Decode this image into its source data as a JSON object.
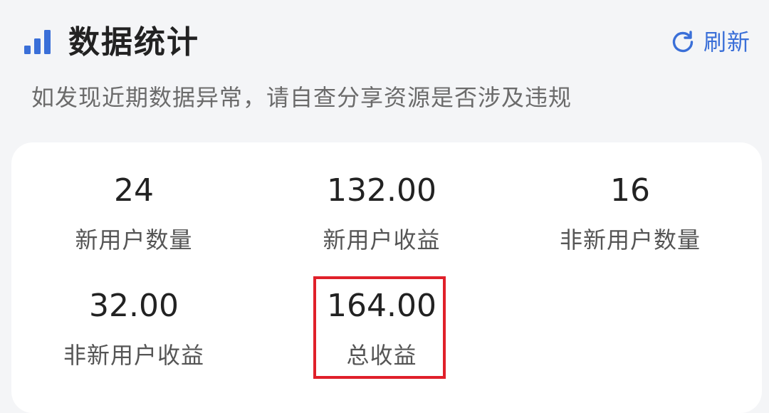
{
  "header": {
    "title": "数据统计",
    "refresh_label": "刷新",
    "icon": "bar-chart-icon",
    "refresh_icon": "refresh-icon",
    "accent_color": "#3a6fd8"
  },
  "notice": "如发现近期数据异常，请自查分享资源是否涉及违规",
  "stats": [
    {
      "value": "24",
      "label": "新用户数量"
    },
    {
      "value": "132.00",
      "label": "新用户收益"
    },
    {
      "value": "16",
      "label": "非新用户数量"
    },
    {
      "value": "32.00",
      "label": "非新用户收益"
    },
    {
      "value": "164.00",
      "label": "总收益"
    }
  ],
  "highlight_color": "#e0202a"
}
